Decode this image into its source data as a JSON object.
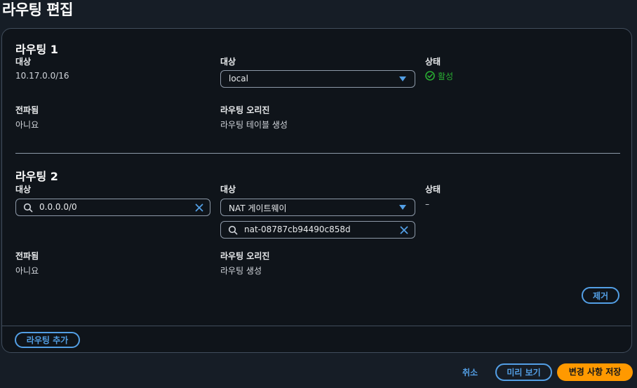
{
  "page": {
    "title": "라우팅 편집"
  },
  "routes": [
    {
      "title": "라우팅 1",
      "destination_label": "대상",
      "destination_value": "10.17.0.0/16",
      "target_label": "대상",
      "target_select": "local",
      "status_label": "상태",
      "status_value": "활성",
      "propagated_label": "전파됨",
      "propagated_value": "아니요",
      "origin_label": "라우팅 오리진",
      "origin_value": "라우팅 테이블 생성"
    },
    {
      "title": "라우팅 2",
      "destination_label": "대상",
      "destination_input": "0.0.0.0/0",
      "target_label": "대상",
      "target_select": "NAT 게이트웨이",
      "target_search": "nat-08787cb94490c858d",
      "status_label": "상태",
      "status_value": "–",
      "propagated_label": "전파됨",
      "propagated_value": "아니요",
      "origin_label": "라우팅 오리진",
      "origin_value": "라우팅 생성",
      "remove_label": "제거"
    }
  ],
  "actions": {
    "add_route": "라우팅 추가",
    "cancel": "취소",
    "preview": "미리 보기",
    "save": "변경 사항 저장"
  },
  "icons": [
    "search-icon",
    "clear-icon",
    "caret-down-icon",
    "check-circle-icon"
  ],
  "colors": {
    "accent": "#539fe5",
    "success": "#29ad32",
    "primary": "#ff9900",
    "background": "#0f141a"
  }
}
